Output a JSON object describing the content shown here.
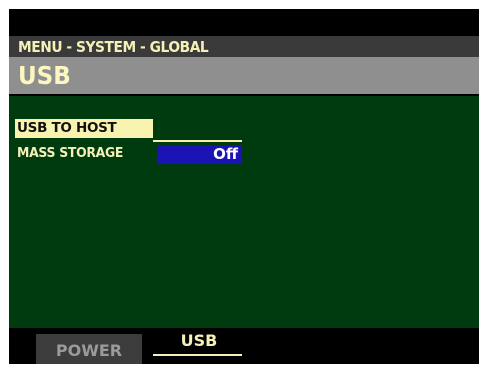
{
  "header": {
    "menu_path": "MENU - SYSTEM - GLOBAL",
    "page_title": "USB"
  },
  "settings": {
    "usb_to_host_label": "USB TO HOST",
    "mass_storage_label": "MASS STORAGE",
    "mass_storage_value": "Off"
  },
  "tabs": [
    {
      "label": "POWER",
      "active": false
    },
    {
      "label": "USB",
      "active": true
    }
  ],
  "colors": {
    "background": "#000000",
    "content_green": "#003b10",
    "title_gray": "#8f8f8f",
    "highlight_yellow": "#f8f4b0",
    "value_blue": "#1c13b5"
  }
}
